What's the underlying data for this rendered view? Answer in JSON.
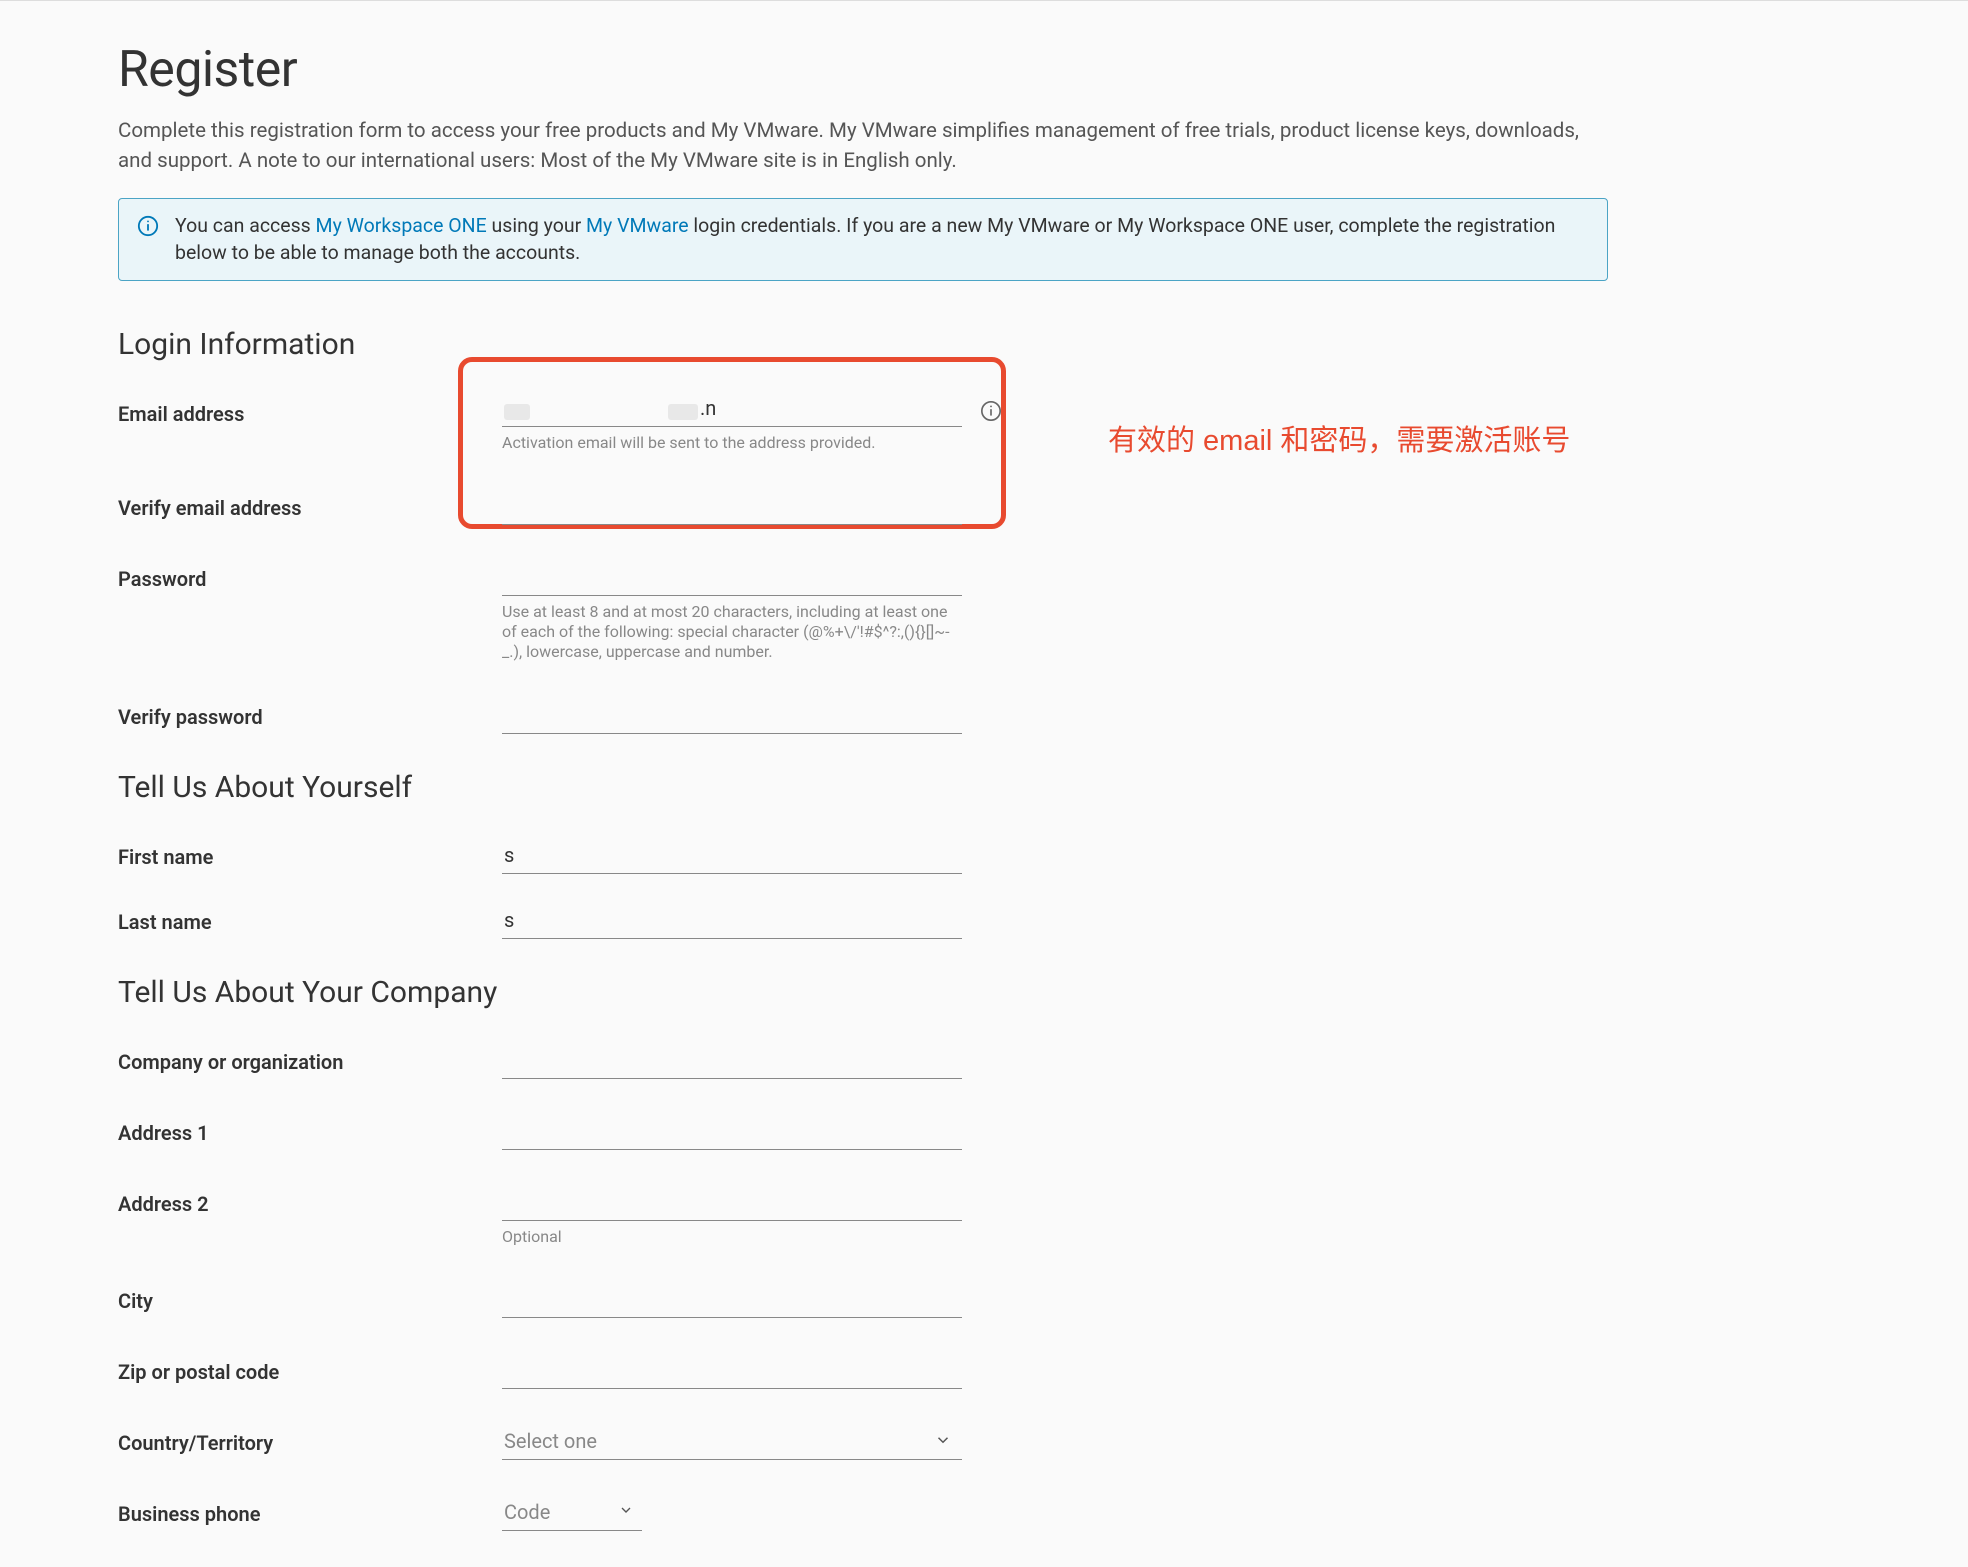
{
  "header": {
    "title": "Register",
    "intro": "Complete this registration form to access your free products and My VMware. My VMware simplifies management of free trials, product license keys, downloads, and support. A note to our international users: Most of the My VMware site is in English only."
  },
  "banner": {
    "prefix": "You can access ",
    "link1": "My Workspace ONE",
    "mid": " using your ",
    "link2": "My VMware",
    "suffix": " login credentials. If you are a new My VMware or My Workspace ONE user, complete the registration below to be able to manage both the accounts."
  },
  "sections": {
    "login": "Login Information",
    "yourself": "Tell Us About Yourself",
    "company": "Tell Us About Your Company"
  },
  "fields": {
    "email_label": "Email address",
    "email_value_suffix": ".n",
    "email_helper": "Activation email will be sent to the address provided.",
    "verify_email_label": "Verify email address",
    "password_label": "Password",
    "password_helper": "Use at least 8 and at most 20 characters, including at least one of each of the following: special character (@%+\\/'!#$^?:,(){}[]~-_.), lowercase, uppercase and number.",
    "verify_password_label": "Verify password",
    "first_name_label": "First name",
    "first_name_value": "s",
    "last_name_label": "Last name",
    "last_name_value": "s",
    "company_label": "Company or organization",
    "address1_label": "Address 1",
    "address2_label": "Address 2",
    "address2_helper": "Optional",
    "city_label": "City",
    "zip_label": "Zip or postal code",
    "country_label": "Country/Territory",
    "country_placeholder": "Select one",
    "phone_label": "Business phone",
    "phone_code_placeholder": "Code"
  },
  "annotation": {
    "text": "有效的 email 和密码，需要激活账号"
  }
}
